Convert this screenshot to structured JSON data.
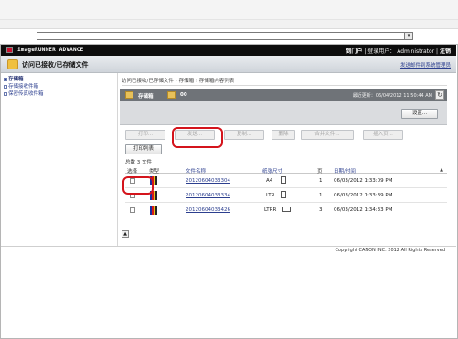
{
  "address_bar": {
    "value": ""
  },
  "brand": {
    "name": "imageRUNNER ADVANCE",
    "portal_link": "到门户",
    "logged_in_label": "登录用户：",
    "user": "Administrator",
    "logout_link": "注销"
  },
  "header": {
    "title": "访问已接收/已存储文件",
    "settings_link": "发送邮件到系统管理员"
  },
  "sidebar": {
    "items": [
      {
        "label": "存储箱",
        "active": true
      },
      {
        "label": "存储接收件箱",
        "active": false
      },
      {
        "label": "保密传真收件箱",
        "active": false
      }
    ]
  },
  "breadcrumb": {
    "parts": [
      "访问已接收/已存储文件",
      "存储箱",
      "存储箱内容列表"
    ],
    "sep": "›"
  },
  "box": {
    "name": "存储箱",
    "number": "00",
    "updated_label": "最近更新：",
    "updated_value": "06/04/2012 11:50:44 AM",
    "refresh_icon": "refresh-icon",
    "settings_button": "设置..."
  },
  "toolbar": {
    "print": "打印...",
    "send": "发送...",
    "copy": "复制...",
    "delete": "删除",
    "merge": "合并文件...",
    "insert": "插入页...",
    "print_list": "打印列表"
  },
  "table": {
    "total": "总数 3 文件",
    "headers": {
      "select": "选择",
      "type": "类型",
      "name": "文件名称",
      "size": "纸张尺寸",
      "pages": "页",
      "datetime": "日期/时间",
      "sort_icon": "▲"
    },
    "rows": [
      {
        "name": "20120604033304",
        "size": "A4",
        "size_icon": "portrait",
        "pages": "1",
        "datetime": "06/03/2012 1:33:09 PM"
      },
      {
        "name": "20120604033334",
        "size": "LTR",
        "size_icon": "portrait",
        "pages": "1",
        "datetime": "06/03/2012 1:33:39 PM"
      },
      {
        "name": "20120604033426",
        "size": "LTRR",
        "size_icon": "landscape",
        "pages": "3",
        "datetime": "06/03/2012 1:34:33 PM"
      }
    ]
  },
  "footer": {
    "copyright": "Copyright CANON INC. 2012 All Rights Reserved"
  },
  "colors": {
    "brandbar": "#0d0d0d",
    "accent_link": "#2c3f8f",
    "annotation": "#d4141c",
    "darkbar": "#6f7378"
  }
}
